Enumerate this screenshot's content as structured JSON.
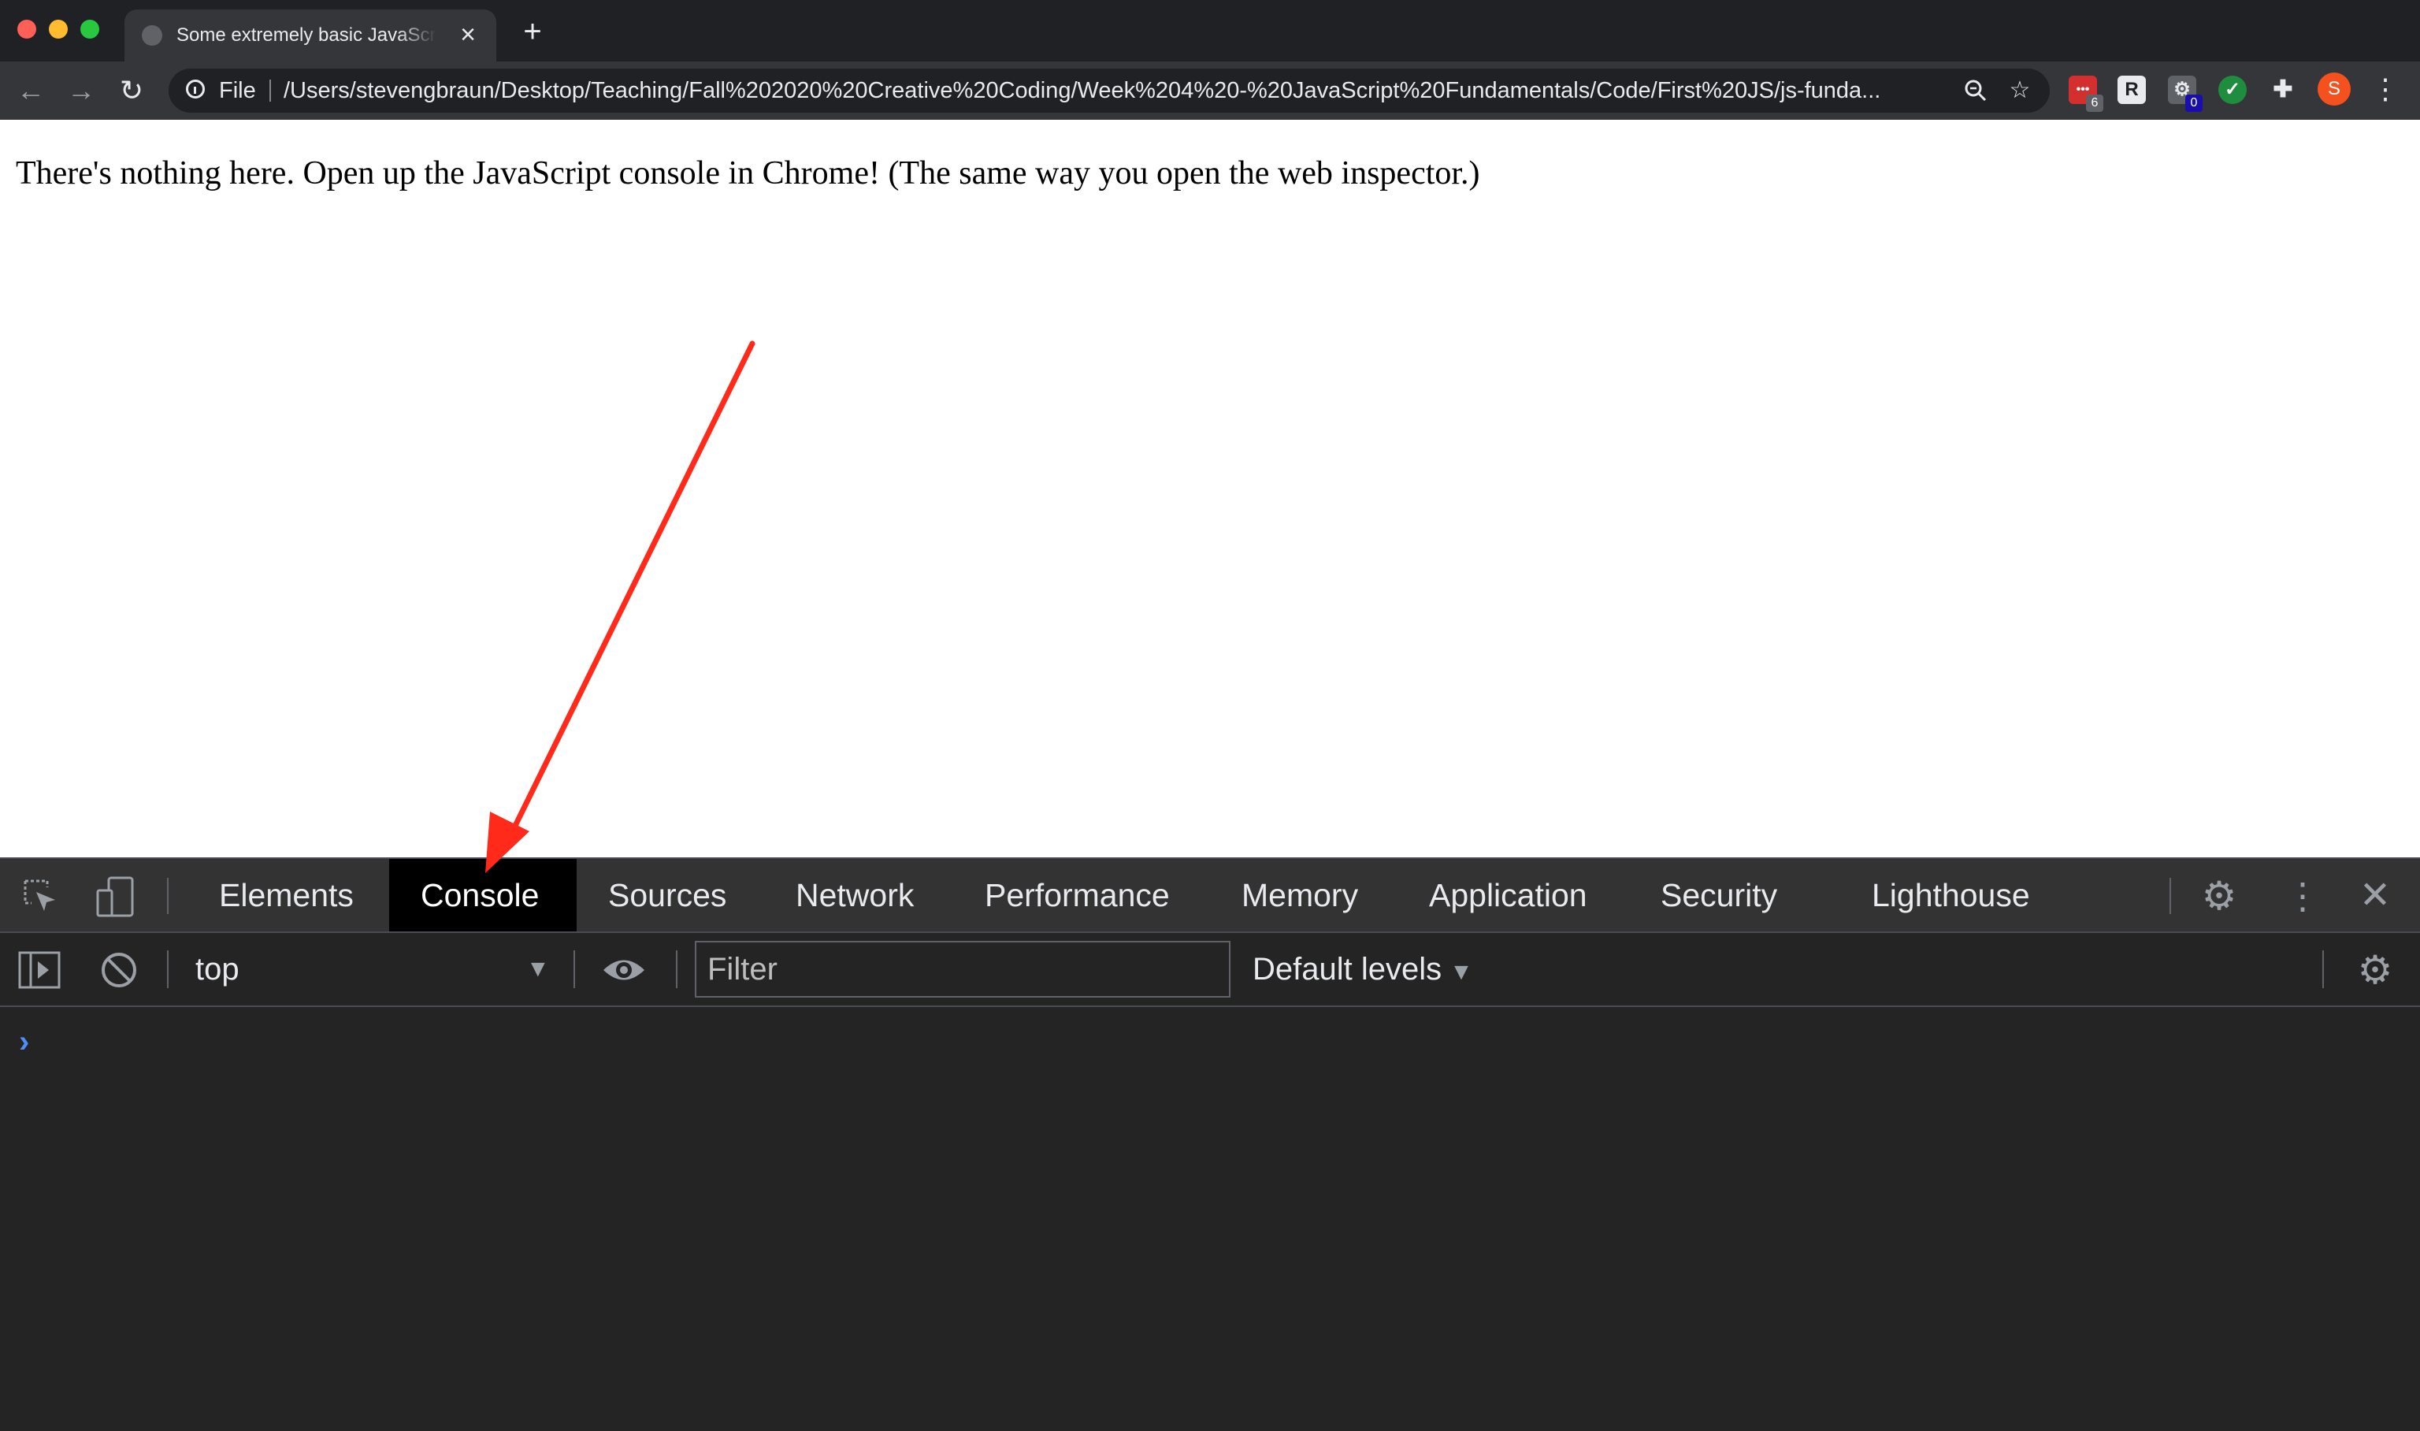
{
  "browser": {
    "tab_title": "Some extremely basic JavaScript",
    "tab_close": "×",
    "new_tab": "+",
    "nav": {
      "back": "←",
      "forward": "→",
      "reload": "↻"
    },
    "omnibox": {
      "scheme": "File",
      "url": "/Users/stevengbraun/Desktop/Teaching/Fall%202020%20Creative%20Coding/Week%204%20-%20JavaScript%20Fundamentals/Code/First%20JS/js-funda..."
    },
    "extensions": [
      {
        "name": "lastpass-extension-icon",
        "glyph": "•••",
        "badge": "6",
        "color": "#d32f2f"
      },
      {
        "name": "r-extension-icon",
        "glyph": "R",
        "badge": "",
        "color": "#e8eaed"
      },
      {
        "name": "gear-extension-icon",
        "glyph": "⚙",
        "badge": "0",
        "color": "#5f6368"
      },
      {
        "name": "check-extension-icon",
        "glyph": "✓",
        "badge": "",
        "color": "#1e8e3e"
      },
      {
        "name": "puzzle-extensions-icon",
        "glyph": "✚",
        "badge": "",
        "color": "#35363a"
      }
    ],
    "profile_initial": "S",
    "menu_glyph": "⋮"
  },
  "page": {
    "text": "There's nothing here. Open up the JavaScript console in Chrome! (The same way you open the web inspector.)"
  },
  "devtools": {
    "tabs": [
      "Elements",
      "Console",
      "Sources",
      "Network",
      "Performance",
      "Memory",
      "Application",
      "Security",
      "Lighthouse"
    ],
    "active_tab": "Console",
    "context": "top",
    "filter_placeholder": "Filter",
    "levels_label": "Default levels",
    "prompt_glyph": "›"
  },
  "colors": {
    "annotation_arrow": "#ff2a1a",
    "active_tab_bg": "#000000",
    "prompt": "#4d8ef8"
  }
}
